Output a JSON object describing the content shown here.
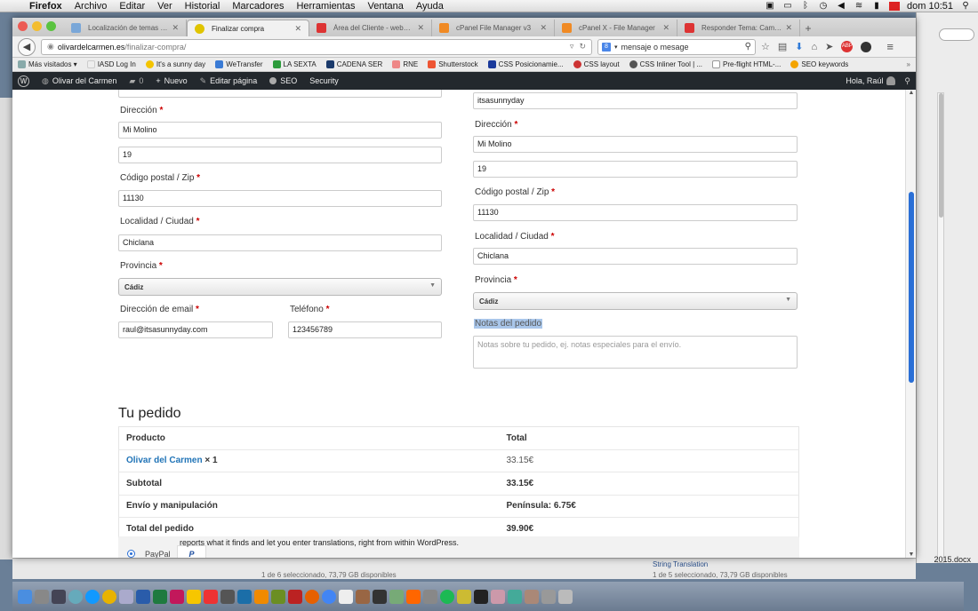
{
  "menubar": {
    "app": "Firefox",
    "items": [
      "Archivo",
      "Editar",
      "Ver",
      "Historial",
      "Marcadores",
      "Herramientas",
      "Ventana",
      "Ayuda"
    ],
    "clock": "dom 10:51"
  },
  "tabs": [
    {
      "label": "Localización de temas y plugi...",
      "color": "#7aa7d8"
    },
    {
      "label": "Finalizar compra",
      "color": "#e0c400",
      "active": true
    },
    {
      "label": "Área del Cliente - webem...",
      "color": "#d33"
    },
    {
      "label": "cPanel File Manager v3",
      "color": "#f08a24"
    },
    {
      "label": "cPanel X - File Manager",
      "color": "#f08a24"
    },
    {
      "label": "Responder Tema: Cambia...",
      "color": "#d33"
    }
  ],
  "newtab": "+",
  "url": {
    "domain": "olivardelcarmen.es",
    "path": "/finalizar-compra/"
  },
  "search": {
    "engine": "8",
    "value": "mensaje o mesage"
  },
  "bookmarks": [
    {
      "label": "Más visitados ▾",
      "color": "#8aa"
    },
    {
      "label": "IASD Log In",
      "color": "#eee"
    },
    {
      "label": "It's a sunny day",
      "color": "#f4c400"
    },
    {
      "label": "WeTransfer",
      "color": "#3a7bd5"
    },
    {
      "label": "LA SEXTA",
      "color": "#2c9b3c"
    },
    {
      "label": "CADENA SER",
      "color": "#1b3a6b"
    },
    {
      "label": "RNE",
      "color": "#e88"
    },
    {
      "label": "Shutterstock",
      "color": "#e53"
    },
    {
      "label": "CSS Posicionamie...",
      "color": "#1b3a9b"
    },
    {
      "label": "CSS layout",
      "color": "#c33"
    },
    {
      "label": "CSS Inliner Tool | ...",
      "color": "#555"
    },
    {
      "label": "Pre-flight HTML-...",
      "color": "#fff"
    },
    {
      "label": "SEO keywords",
      "color": "#f4a400"
    }
  ],
  "bookmarks_more": "»",
  "wpbar": {
    "site": "Olivar del Carmen",
    "comments": "0",
    "new": "Nuevo",
    "edit": "Editar página",
    "seo": "SEO",
    "security": "Security",
    "greeting": "Hola, Raúl"
  },
  "billing": {
    "address_label": "Dirección",
    "address1": "Mi Molino",
    "address2": "19",
    "zip_label": "Código postal / Zip",
    "zip": "11130",
    "city_label": "Localidad / Ciudad",
    "city": "Chiclana",
    "province_label": "Provincia",
    "province": "Cádiz",
    "email_label": "Dirección de email",
    "email": "raul@itsasunnyday.com",
    "phone_label": "Teléfono",
    "phone": "123456789"
  },
  "shipping": {
    "company": "itsasunnyday",
    "address_label": "Dirección",
    "address1": "Mi Molino",
    "address2": "19",
    "zip_label": "Código postal / Zip",
    "zip": "11130",
    "city_label": "Localidad / Ciudad",
    "city": "Chiclana",
    "province_label": "Provincia",
    "province": "Cádiz",
    "notes_label": "Notas del pedido",
    "notes_placeholder": "Notas sobre tu pedido, ej. notas especiales para el envío."
  },
  "required_mark": "*",
  "order": {
    "title": "Tu pedido",
    "col_product": "Producto",
    "col_total": "Total",
    "product_name": "Olivar del Carmen",
    "product_qty": " × 1",
    "product_total": "33.15€",
    "subtotal_label": "Subtotal",
    "subtotal": "33.15€",
    "shipping_label": "Envío y manipulación",
    "shipping": "Península: 6.75€",
    "total_label": "Total del pedido",
    "total": "39.90€"
  },
  "payment": {
    "method": "PayPal",
    "logo": "P"
  },
  "background": {
    "overlay": "reports what it finds and let you enter translations, right from within WordPress.",
    "status_left": "1 de 6 seleccionado, 73,79 GB disponibles",
    "link_right": "String Translation",
    "status_right": "1 de 5 seleccionado, 73,79 GB disponibles",
    "docx": "2015.docx"
  }
}
